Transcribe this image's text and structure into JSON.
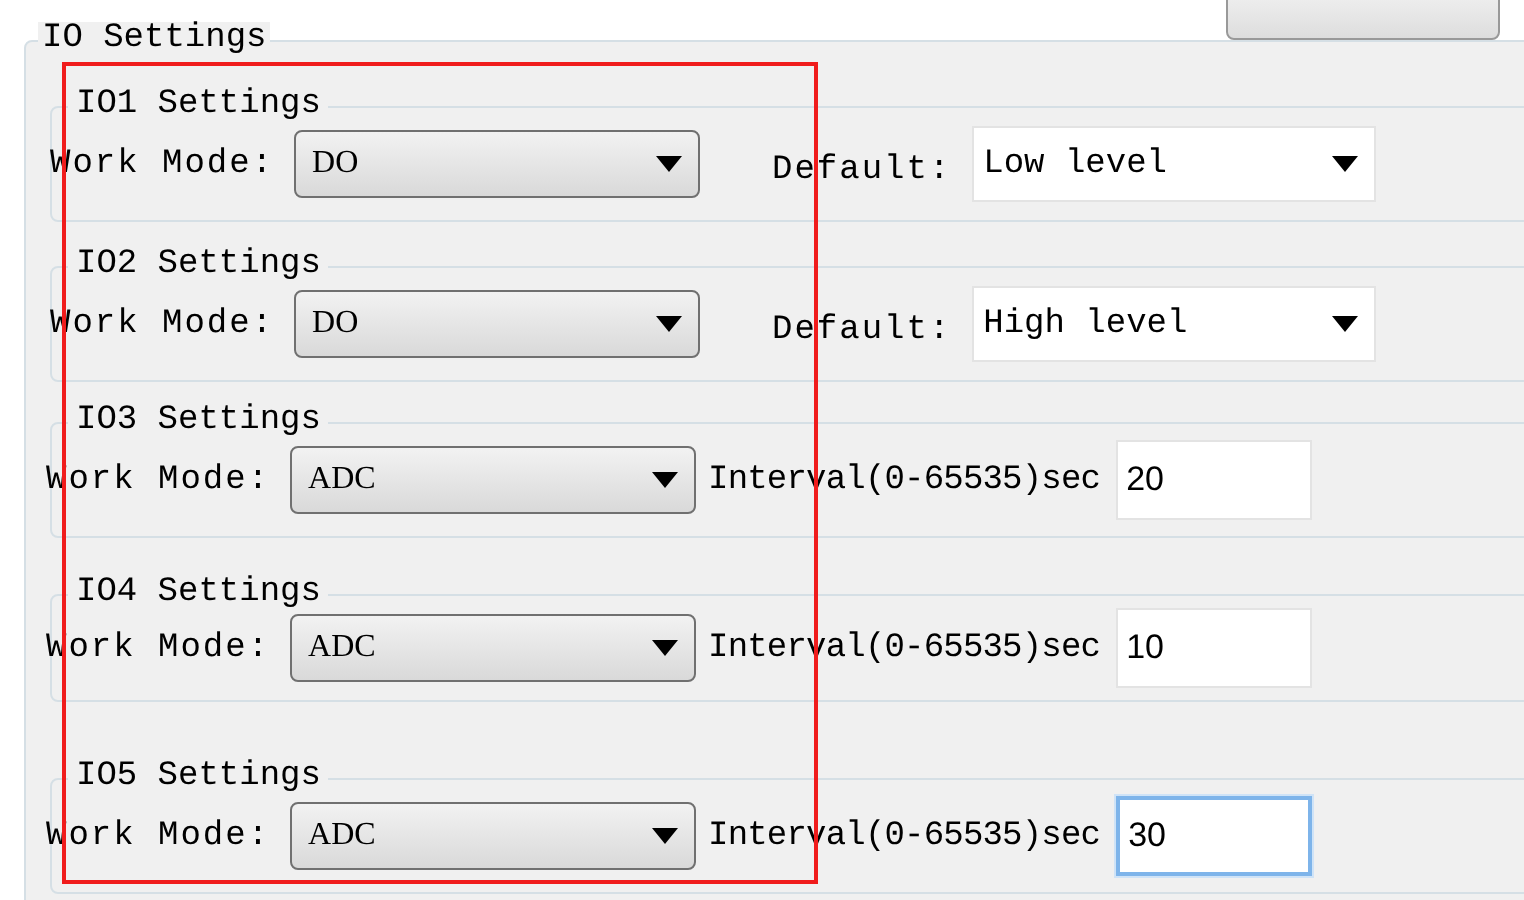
{
  "outer_group": {
    "title": "IO Settings"
  },
  "groups": [
    {
      "title": "IO1 Settings",
      "mode_label": "Work Mode:",
      "mode": "DO",
      "kind": "select",
      "extra_label": "Default:",
      "extra_value": "Low level"
    },
    {
      "title": "IO2 Settings",
      "mode_label": "Work Mode:",
      "mode": "DO",
      "kind": "select",
      "extra_label": "Default:",
      "extra_value": "High level"
    },
    {
      "title": "IO3 Settings",
      "mode_label": "Work Mode:",
      "mode": "ADC",
      "kind": "input",
      "extra_label": "Interval(0-65535)sec",
      "extra_value": "20",
      "focused": false
    },
    {
      "title": "IO4 Settings",
      "mode_label": "Work Mode:",
      "mode": "ADC",
      "kind": "input",
      "extra_label": "Interval(0-65535)sec",
      "extra_value": "10",
      "focused": false
    },
    {
      "title": "IO5 Settings",
      "mode_label": "Work Mode:",
      "mode": "ADC",
      "kind": "input",
      "extra_label": "Interval(0-65535)sec",
      "extra_value": "30",
      "focused": true
    }
  ],
  "annotation": {
    "kind": "box"
  }
}
